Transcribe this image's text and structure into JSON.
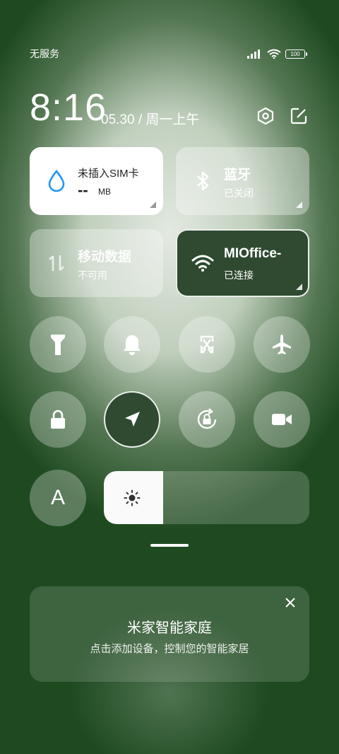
{
  "status_bar": {
    "carrier": "无服务",
    "battery": "100"
  },
  "header": {
    "time": "8:16",
    "date": "05.30 / 周一上午"
  },
  "tiles": {
    "sim": {
      "title": "未插入SIM卡",
      "value": "--",
      "unit": "MB"
    },
    "bluetooth": {
      "title": "蓝牙",
      "status": "已关闭"
    },
    "mobile_data": {
      "title": "移动数据",
      "status": "不可用"
    },
    "wifi": {
      "title": "MIOffice-",
      "status": "已连接"
    }
  },
  "toggles_row1": [
    "flashlight-icon",
    "bell-icon",
    "screenshot-icon",
    "airplane-icon"
  ],
  "toggles_row2": [
    "lock-icon",
    "location-icon",
    "rotation-lock-icon",
    "video-camera-icon"
  ],
  "brightness": {
    "level": 0.29,
    "auto_label": "A"
  },
  "smart_home_card": {
    "title": "米家智能家庭",
    "subtitle": "点击添加设备，控制您的智能家居"
  },
  "colors": {
    "background": "#1f4a20",
    "active_tile": "#2f4a31",
    "brightness_fill": "#fafafa"
  }
}
